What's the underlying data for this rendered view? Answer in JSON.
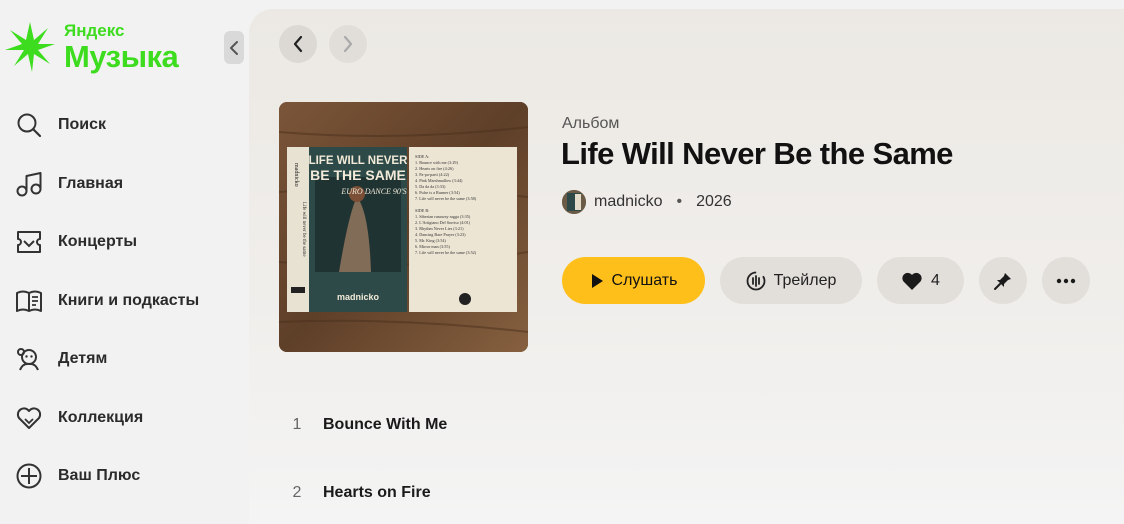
{
  "sidebar": {
    "logo_small": "Яндекс",
    "logo_big": "Музыка",
    "items": [
      {
        "label": "Поиск",
        "icon": "search-icon"
      },
      {
        "label": "Главная",
        "icon": "music-note-icon"
      },
      {
        "label": "Концерты",
        "icon": "ticket-icon"
      },
      {
        "label": "Книги и подкасты",
        "icon": "book-icon"
      },
      {
        "label": "Детям",
        "icon": "kids-icon"
      },
      {
        "label": "Коллекция",
        "icon": "heart-icon"
      },
      {
        "label": "Ваш Плюс",
        "icon": "plus-circle-icon"
      }
    ],
    "brand_color": "#3ddc1e"
  },
  "album": {
    "type": "Альбом",
    "title": "Life Will Never Be the Same",
    "artist": "madnicko",
    "separator": "•",
    "year": "2026",
    "cover_text": {
      "line1": "LIFE WILL NEVER",
      "line2": "BE THE SAME",
      "subtitle": "EURO DANCE 90'S",
      "artist": "madnicko",
      "spine": "Life will never be the same",
      "side_a_label": "SIDE A:",
      "side_a": [
        "1. Bounce with me (3:29)",
        "2. Hearts on fire (4:26)",
        "3. Pa-pa-parti (4:22)",
        "4. Pink Marshmallow (3:44)",
        "5. Da da da (3:33)",
        "6. Pulse is a Runner (3:54)",
        "7. Life will never be the same (3:58)"
      ],
      "side_b_label": "SIDE B:",
      "side_b": [
        "1. Siberian runaway ragga (3:35)",
        "2. L'Artigiano Del Sorriso (4:01)",
        "3. Rhythm Never Lies (3:21)",
        "4. Dancing Bare Prayer (3:23)",
        "5. Mr. King (3:54)",
        "6. Mirror man (3:55)",
        "7. Life will never be the same (3:52)"
      ]
    }
  },
  "actions": {
    "play_label": "Слушать",
    "trailer_label": "Трейлер",
    "likes_count": "4",
    "accent_color": "#ffbf1a"
  },
  "tracks": [
    {
      "num": "1",
      "title": "Bounce With Me"
    },
    {
      "num": "2",
      "title": "Hearts on Fire"
    }
  ]
}
